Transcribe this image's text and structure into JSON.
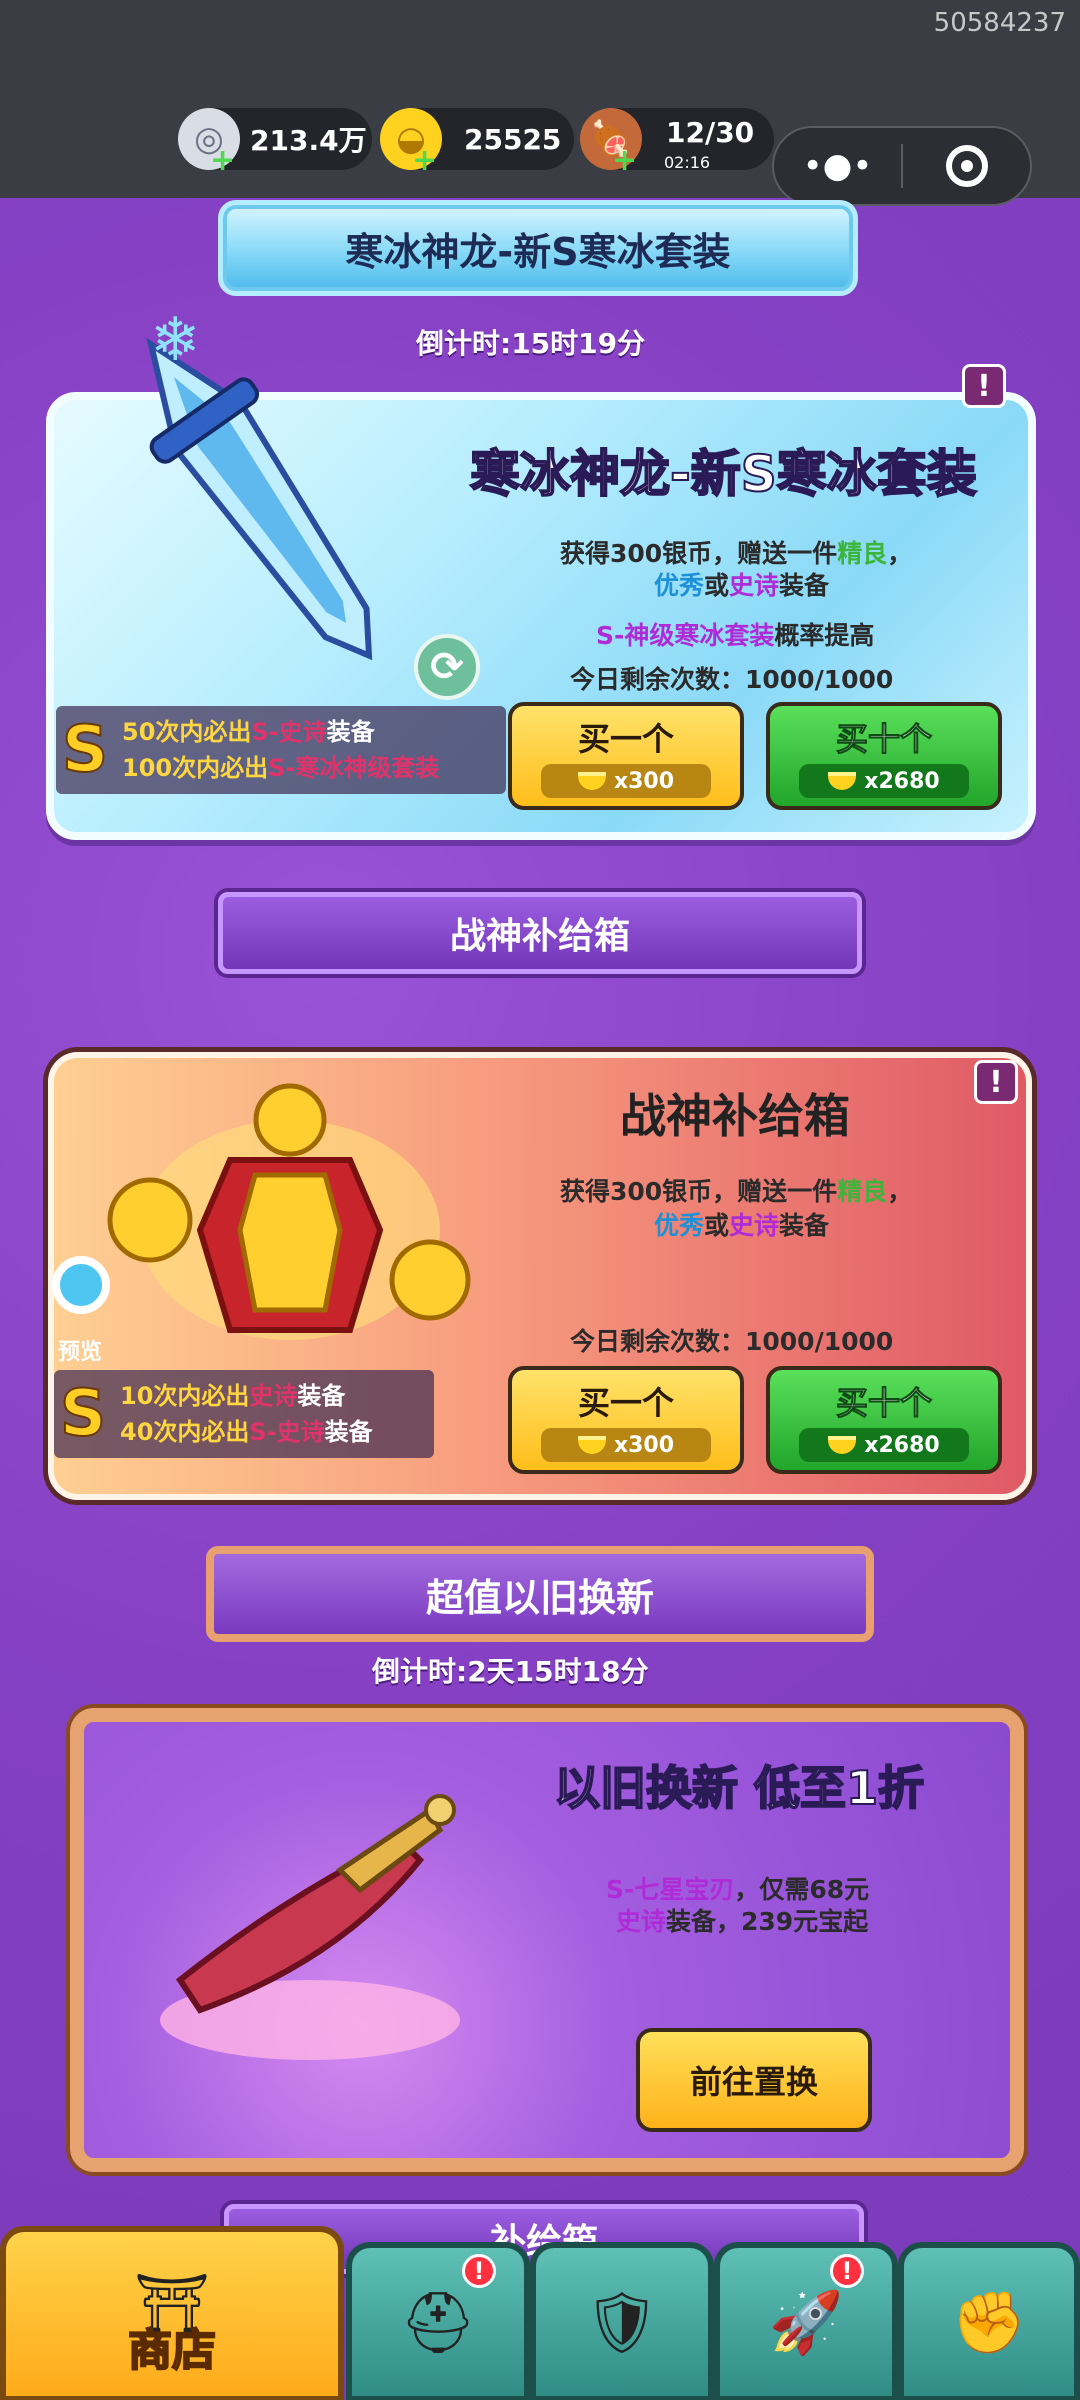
{
  "status": {
    "uid": "50584237"
  },
  "resources": [
    {
      "icon": "silver-coin-icon",
      "value": "213.4万"
    },
    {
      "icon": "gold-ingot-icon",
      "value": "25525"
    },
    {
      "icon": "meat-stamina-icon",
      "value": "12/30",
      "sub": "02:16"
    }
  ],
  "ice_event": {
    "banner_title": "寒冰神龙-新S寒冰套装",
    "countdown": "倒计时:15时19分",
    "card_title": "寒冰神龙-新S寒冰套装",
    "desc_prefix": "获得300银币，赠送一件",
    "desc_g": "精良",
    "desc_sep": "，",
    "desc_b": "优秀",
    "desc_or": "或",
    "desc_p": "史诗",
    "desc_suffix": "装备",
    "boost_p": "S-神级寒冰套装",
    "boost_suffix": "概率提高",
    "remaining": "今日剩余次数：1000/1000",
    "s_line1_prefix": "50次内必出",
    "s_line1_em": "S-史诗",
    "s_line1_suffix": "装备",
    "s_line2_prefix": "100次内必出",
    "s_line2_em": "S-寒冰神级套装",
    "buy1_label": "买一个",
    "buy1_price": "x300",
    "buy10_label": "买十个",
    "buy10_price": "x2680"
  },
  "war_box": {
    "banner_title": "战神补给箱",
    "card_title": "战神补给箱",
    "desc_prefix": "获得300银币，赠送一件",
    "desc_g": "精良",
    "desc_sep": "，",
    "desc_b": "优秀",
    "desc_or": "或",
    "desc_p": "史诗",
    "desc_suffix": "装备",
    "preview": "预览",
    "remaining": "今日剩余次数：1000/1000",
    "s_line1_prefix": "10次内必出",
    "s_line1_em": "史诗",
    "s_line1_suffix": "装备",
    "s_line2_prefix": "40次内必出",
    "s_line2_em": "S-史诗",
    "s_line2_suffix": "装备",
    "buy1_label": "买一个",
    "buy1_price": "x300",
    "buy10_label": "买十个",
    "buy10_price": "x2680"
  },
  "trade_in": {
    "banner_title": "超值以旧换新",
    "countdown": "倒计时:2天15时18分",
    "card_title": "以旧换新 低至1折",
    "line1_em": "S-七星宝刃",
    "line1_suffix": "，仅需68元",
    "line2_em": "史诗",
    "line2_suffix": "装备，239元宝起",
    "button": "前往置换"
  },
  "next_section": {
    "banner_title": "补给箱"
  },
  "bottom_nav": {
    "shop_label": "商店",
    "tabs": [
      {
        "icon": "helmet-icon",
        "badge": "!"
      },
      {
        "icon": "armor-tile-icon"
      },
      {
        "icon": "rocket-stars-icon",
        "badge": "!"
      },
      {
        "icon": "fist-upgrade-icon"
      }
    ]
  }
}
